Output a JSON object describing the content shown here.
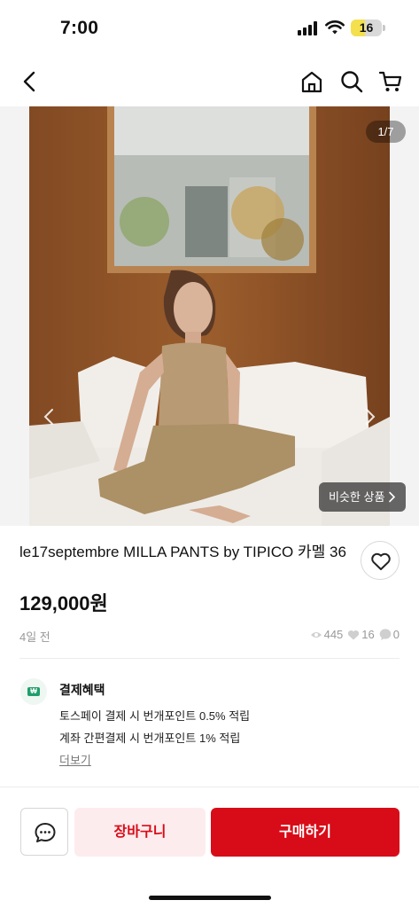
{
  "status_bar": {
    "time": "7:00",
    "battery": "16",
    "battery_level": 0.16,
    "icons": [
      "signal-icon",
      "wifi-icon",
      "battery-icon"
    ]
  },
  "nav": {
    "icons": [
      "back-icon",
      "home-icon",
      "search-icon",
      "cart-icon"
    ]
  },
  "gallery": {
    "counter": "1/7",
    "similar_button": "비슷한 상품",
    "icons": [
      "chevron-left-icon",
      "chevron-right-icon",
      "chevron-right-icon"
    ]
  },
  "product": {
    "title": "le17septembre MILLA PANTS by TIPICO 카멜 36",
    "price": "129,000원",
    "posted": "4일 전",
    "views": "445",
    "likes": "16",
    "chats": "0",
    "icons": [
      "heart-icon",
      "eye-icon",
      "chat-count-icon"
    ]
  },
  "benefits": {
    "title": "결제혜택",
    "badge": "₩",
    "lines": [
      "토스페이 결제 시 번개포인트 0.5% 적립",
      "계좌 간편결제 시 번개포인트 1% 적립"
    ],
    "more": "더보기"
  },
  "actions": {
    "cart": "장바구니",
    "buy": "구매하기",
    "icons": [
      "chat-icon"
    ]
  },
  "colors": {
    "accent": "#d80c18",
    "accent_light": "#fdecee",
    "benefit_green": "#1f9e6b",
    "battery_yellow": "#f4e04d"
  }
}
